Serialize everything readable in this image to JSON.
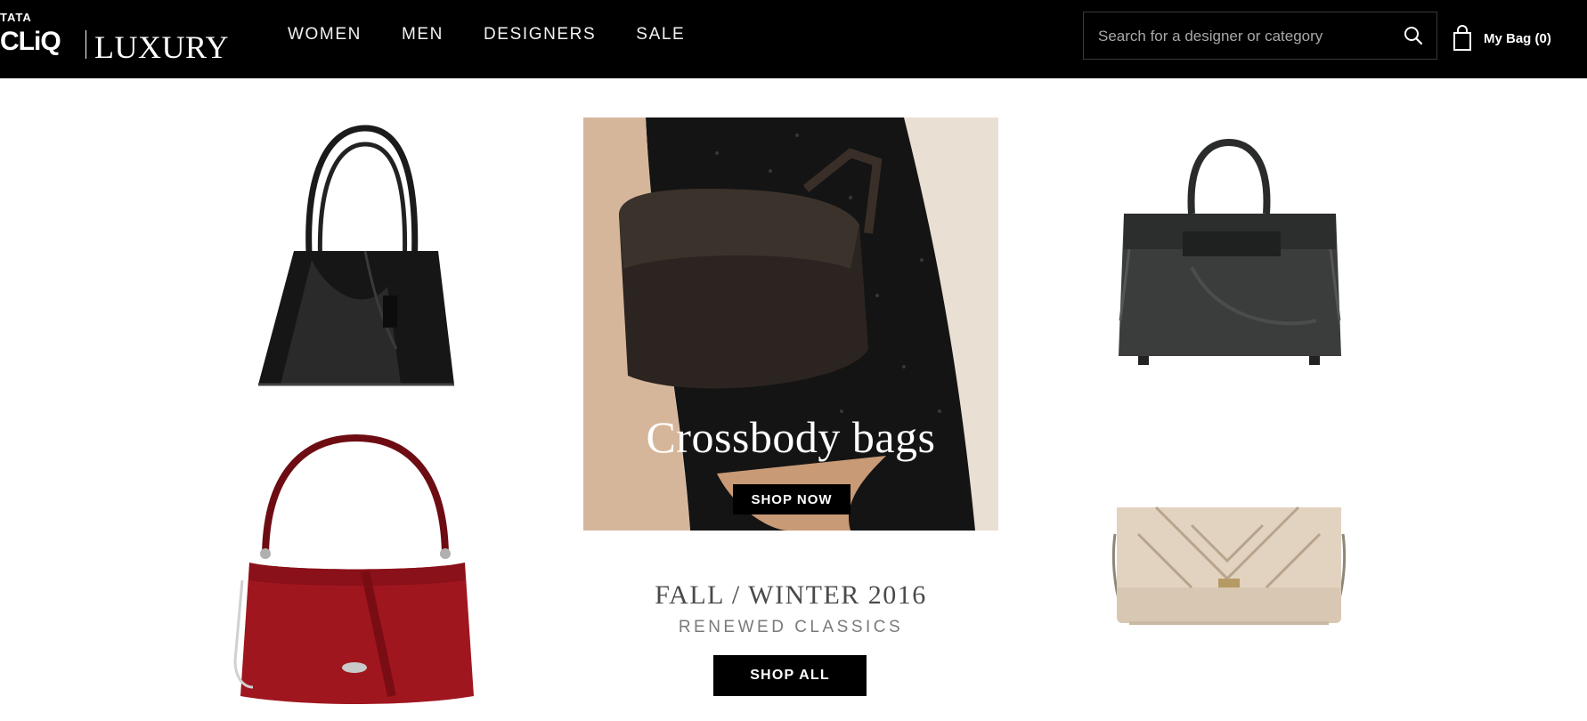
{
  "header": {
    "logo": {
      "tata": "TATA",
      "cliq": "CLiQ",
      "luxury": "LUXURY"
    },
    "nav": [
      "WOMEN",
      "MEN",
      "DESIGNERS",
      "SALE"
    ],
    "search": {
      "placeholder": "Search for a designer or category",
      "icon": "search-icon"
    },
    "bag": {
      "label": "My Bag (0)",
      "icon": "shopping-bag-icon"
    }
  },
  "hero": {
    "title": "Crossbody bags",
    "button": "SHOP NOW"
  },
  "collection": {
    "season": "FALL / WINTER 2016",
    "subtitle": "RENEWED CLASSICS",
    "button": "SHOP ALL"
  },
  "colors": {
    "header_bg": "#000000",
    "red_bag": "#a0161f",
    "black_bag": "#1a1a1a",
    "gray_bag": "#3a3d3c",
    "gold_bag": "#d8c7b2"
  }
}
